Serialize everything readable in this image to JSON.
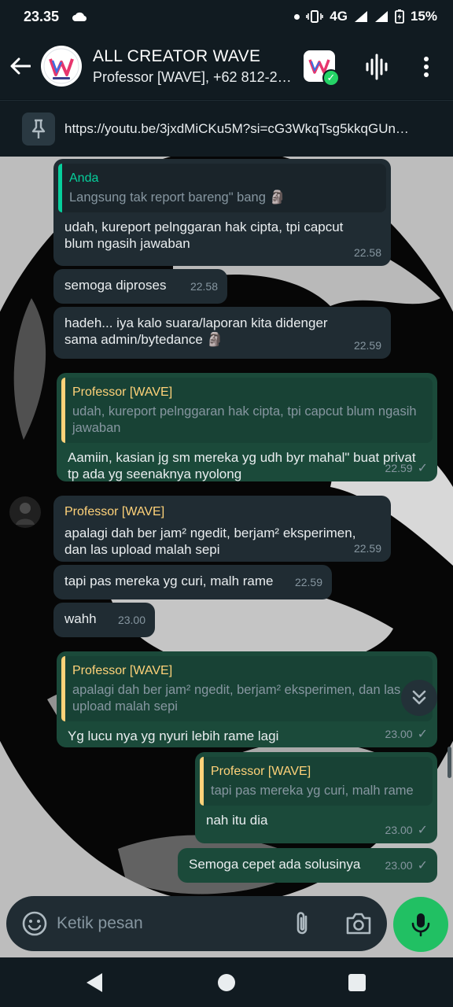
{
  "status_bar": {
    "time": "23.35",
    "network": "4G",
    "battery": "15%"
  },
  "header": {
    "title": "ALL CREATOR WAVE",
    "subtitle": "Professor [WAVE], +62 812-2…"
  },
  "pinned": {
    "text": "https://youtu.be/3jxdMiCKu5M?si=cG3WkqTsg5kkqGUn…"
  },
  "messages": [
    {
      "direction": "in",
      "quote_name": "Anda",
      "quote_text": "Langsung tak report bareng\" bang 🗿",
      "text": "udah, kureport pelnggaran hak cipta, tpi capcut blum ngasih jawaban",
      "time": "22.58"
    },
    {
      "direction": "in",
      "text": "semoga diproses",
      "time": "22.58"
    },
    {
      "direction": "in",
      "text": "hadeh... iya kalo suara/laporan kita didenger sama admin/bytedance 🗿",
      "time": "22.59"
    },
    {
      "direction": "out",
      "quote_name": "Professor [WAVE]",
      "quote_text": "udah, kureport pelnggaran hak cipta, tpi capcut blum ngasih jawaban",
      "text": "Aamiin, kasian jg sm mereka yg udh byr mahal\" buat privat tp ada yg seenaknya nyolong",
      "time": "22.59"
    },
    {
      "direction": "in",
      "sender": "Professor [WAVE]",
      "text": "apalagi dah ber jam² ngedit, berjam² eksperimen, dan las upload malah sepi",
      "time": "22.59"
    },
    {
      "direction": "in",
      "text": "tapi pas mereka yg curi, malh rame",
      "time": "22.59"
    },
    {
      "direction": "in",
      "text": "wahh",
      "time": "23.00"
    },
    {
      "direction": "out",
      "quote_name": "Professor [WAVE]",
      "quote_text": "apalagi dah ber jam² ngedit, berjam² eksperimen, dan las upload malah sepi",
      "text": "Yg lucu nya yg nyuri lebih rame lagi",
      "time": "23.00"
    },
    {
      "direction": "out",
      "quote_name": "Professor [WAVE]",
      "quote_text": "tapi pas mereka yg curi, malh rame",
      "text": "nah itu dia",
      "time": "23.00"
    },
    {
      "direction": "out",
      "text": "Semoga cepet ada solusinya",
      "time": "23.00"
    }
  ],
  "composer": {
    "placeholder": "Ketik pesan"
  },
  "icons": {
    "back": "arrow-left-icon",
    "voice_call": "audio-wave-icon",
    "menu": "more-vert-icon",
    "pin": "pin-icon",
    "emoji": "emoji-icon",
    "attach": "paperclip-icon",
    "camera": "camera-icon",
    "mic": "mic-icon",
    "scroll_down": "double-chevron-down-icon"
  },
  "colors": {
    "incoming_bubble": "#202c33",
    "outgoing_bubble": "#1b4a3a",
    "accent_green": "#21c063",
    "quote_yellow": "#ffd279",
    "quote_teal": "#06cf9c"
  }
}
